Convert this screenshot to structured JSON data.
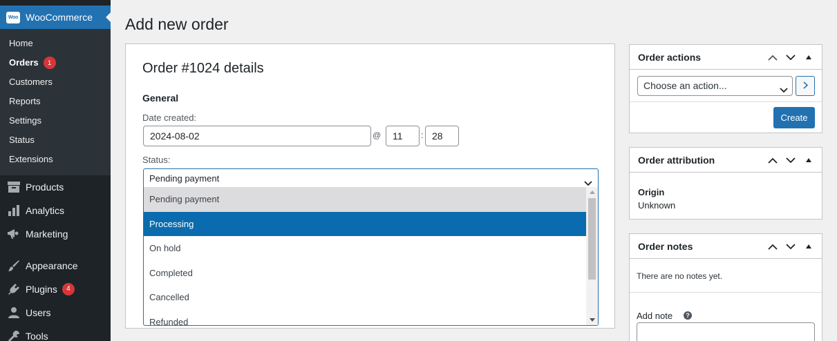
{
  "sidebar": {
    "app_title": "WooCommerce",
    "logo_text": "Woo",
    "submenu": [
      {
        "label": "Home"
      },
      {
        "label": "Orders",
        "badge": "1"
      },
      {
        "label": "Customers"
      },
      {
        "label": "Reports"
      },
      {
        "label": "Settings"
      },
      {
        "label": "Status"
      },
      {
        "label": "Extensions"
      }
    ],
    "menu": [
      {
        "label": "Products",
        "icon": "archive-icon"
      },
      {
        "label": "Analytics",
        "icon": "bar-chart-icon"
      },
      {
        "label": "Marketing",
        "icon": "megaphone-icon"
      },
      {
        "label": "Appearance",
        "icon": "paintbrush-icon"
      },
      {
        "label": "Plugins",
        "icon": "plugin-icon",
        "badge": "4"
      },
      {
        "label": "Users",
        "icon": "user-icon"
      },
      {
        "label": "Tools",
        "icon": "wrench-icon"
      }
    ]
  },
  "page": {
    "title": "Add new order"
  },
  "order": {
    "title": "Order #1024 details",
    "section": "General",
    "date_label": "Date created:",
    "date_value": "2024-08-02",
    "at_symbol": "@",
    "hour_value": "11",
    "time_separator": ":",
    "minute_value": "28",
    "status_label": "Status:",
    "status_value": "Pending payment",
    "status_options": [
      {
        "label": "Pending payment",
        "state": "hover"
      },
      {
        "label": "Processing",
        "state": "selected"
      },
      {
        "label": "On hold",
        "state": ""
      },
      {
        "label": "Completed",
        "state": ""
      },
      {
        "label": "Cancelled",
        "state": ""
      },
      {
        "label": "Refunded",
        "state": ""
      }
    ]
  },
  "order_actions": {
    "title": "Order actions",
    "select_placeholder": "Choose an action...",
    "create_label": "Create"
  },
  "order_attribution": {
    "title": "Order attribution",
    "origin_label": "Origin",
    "origin_value": "Unknown"
  },
  "order_notes": {
    "title": "Order notes",
    "empty_text": "There are no notes yet.",
    "add_note_label": "Add note",
    "help_symbol": "?"
  },
  "colors": {
    "admin_bar": "#1d2327",
    "accent": "#2271b1",
    "selected_option": "#0a6cae",
    "badge": "#d63638"
  }
}
